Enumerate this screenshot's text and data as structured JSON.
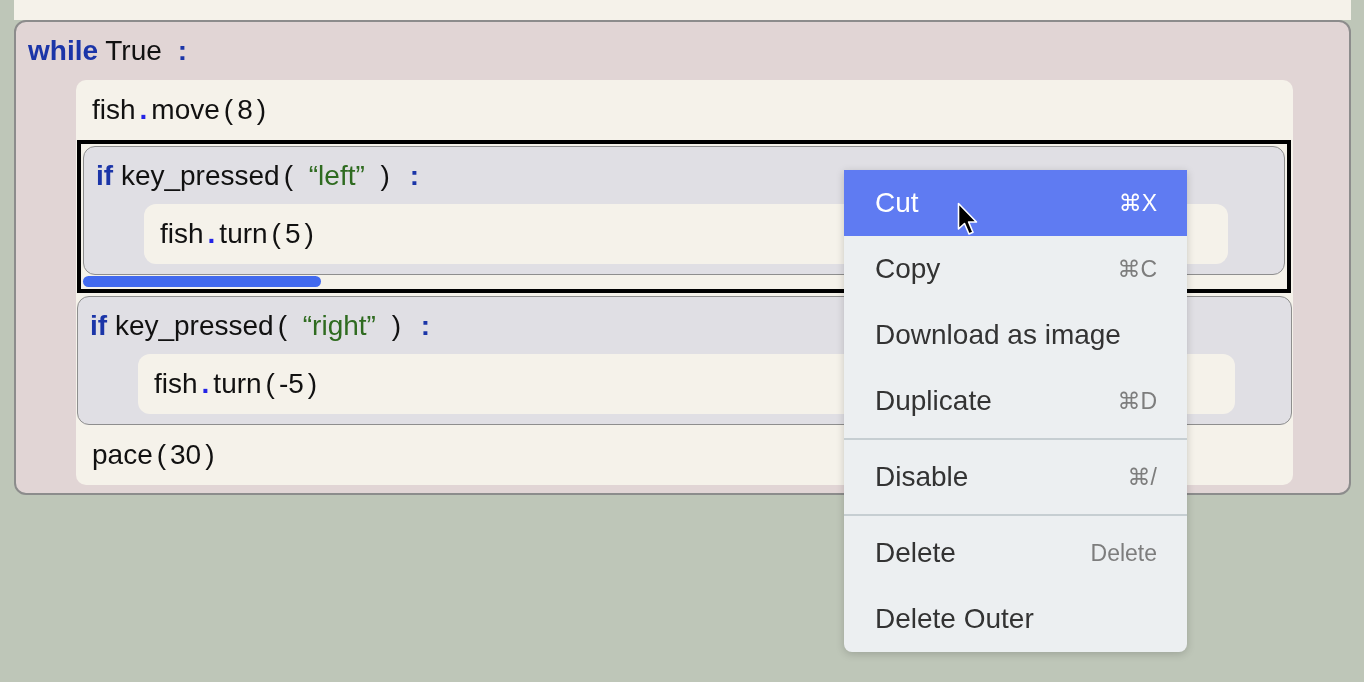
{
  "loop": {
    "kind": "while",
    "tokens": [
      {
        "kind": "keyword",
        "text": "while"
      },
      {
        "kind": "name",
        "text": "True"
      },
      {
        "kind": "colon",
        "text": ":"
      }
    ],
    "children": [
      {
        "kind": "statement",
        "selected": false,
        "tokens": [
          {
            "kind": "name",
            "text": "fish"
          },
          {
            "kind": "dot",
            "text": "."
          },
          {
            "kind": "name",
            "text": "move"
          },
          {
            "kind": "paren",
            "text": "("
          },
          {
            "kind": "name",
            "text": "8"
          },
          {
            "kind": "paren",
            "text": ")"
          }
        ]
      },
      {
        "kind": "if",
        "selected": true,
        "tokens": [
          {
            "kind": "keyword",
            "text": "if"
          },
          {
            "kind": "name",
            "text": "key_pressed"
          },
          {
            "kind": "paren",
            "text": "("
          },
          {
            "kind": "string",
            "text": "“left”"
          },
          {
            "kind": "paren",
            "text": ")"
          },
          {
            "kind": "colon",
            "text": ":"
          }
        ],
        "children": [
          {
            "kind": "statement",
            "selected": false,
            "tokens": [
              {
                "kind": "name",
                "text": "fish"
              },
              {
                "kind": "dot",
                "text": "."
              },
              {
                "kind": "name",
                "text": "turn"
              },
              {
                "kind": "paren",
                "text": "("
              },
              {
                "kind": "name",
                "text": "5"
              },
              {
                "kind": "paren",
                "text": ")"
              }
            ]
          }
        ]
      },
      {
        "kind": "if",
        "selected": false,
        "tokens": [
          {
            "kind": "keyword",
            "text": "if"
          },
          {
            "kind": "name",
            "text": "key_pressed"
          },
          {
            "kind": "paren",
            "text": "("
          },
          {
            "kind": "string",
            "text": "“right”"
          },
          {
            "kind": "paren",
            "text": ")"
          },
          {
            "kind": "colon",
            "text": ":"
          }
        ],
        "children": [
          {
            "kind": "statement",
            "selected": false,
            "tokens": [
              {
                "kind": "name",
                "text": "fish"
              },
              {
                "kind": "dot",
                "text": "."
              },
              {
                "kind": "name",
                "text": "turn"
              },
              {
                "kind": "paren",
                "text": "("
              },
              {
                "kind": "name",
                "text": "-5"
              },
              {
                "kind": "paren",
                "text": ")"
              }
            ]
          }
        ]
      },
      {
        "kind": "statement",
        "selected": false,
        "tokens": [
          {
            "kind": "name",
            "text": "pace"
          },
          {
            "kind": "paren",
            "text": "("
          },
          {
            "kind": "name",
            "text": "30"
          },
          {
            "kind": "paren",
            "text": ")"
          }
        ]
      }
    ]
  },
  "context_menu": {
    "groups": [
      {
        "items": [
          {
            "label": "Cut",
            "shortcut": "⌘X",
            "selected": true
          },
          {
            "label": "Copy",
            "shortcut": "⌘C",
            "selected": false
          },
          {
            "label": "Download as image",
            "selected": false
          },
          {
            "label": "Duplicate",
            "shortcut": "⌘D",
            "selected": false
          }
        ]
      },
      {
        "items": [
          {
            "label": "Disable",
            "shortcut": "⌘/",
            "selected": false
          }
        ]
      },
      {
        "items": [
          {
            "label": "Delete",
            "shortcut": "Delete",
            "selected": false
          },
          {
            "label": "Delete Outer",
            "selected": false
          }
        ]
      }
    ]
  }
}
